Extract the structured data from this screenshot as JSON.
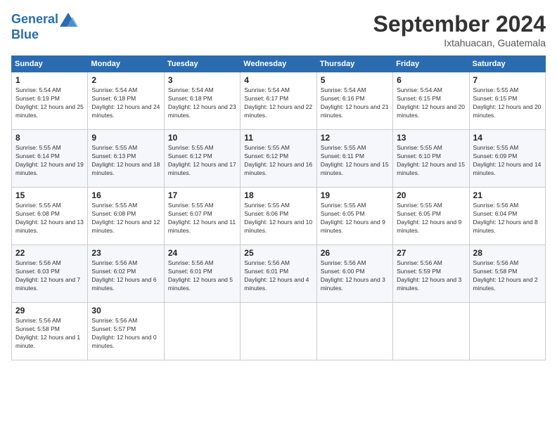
{
  "header": {
    "logo_line1": "General",
    "logo_line2": "Blue",
    "month": "September 2024",
    "location": "Ixtahuacan, Guatemala"
  },
  "days_of_week": [
    "Sunday",
    "Monday",
    "Tuesday",
    "Wednesday",
    "Thursday",
    "Friday",
    "Saturday"
  ],
  "weeks": [
    [
      {
        "day": "1",
        "sunrise": "Sunrise: 5:54 AM",
        "sunset": "Sunset: 6:19 PM",
        "daylight": "Daylight: 12 hours and 25 minutes."
      },
      {
        "day": "2",
        "sunrise": "Sunrise: 5:54 AM",
        "sunset": "Sunset: 6:18 PM",
        "daylight": "Daylight: 12 hours and 24 minutes."
      },
      {
        "day": "3",
        "sunrise": "Sunrise: 5:54 AM",
        "sunset": "Sunset: 6:18 PM",
        "daylight": "Daylight: 12 hours and 23 minutes."
      },
      {
        "day": "4",
        "sunrise": "Sunrise: 5:54 AM",
        "sunset": "Sunset: 6:17 PM",
        "daylight": "Daylight: 12 hours and 22 minutes."
      },
      {
        "day": "5",
        "sunrise": "Sunrise: 5:54 AM",
        "sunset": "Sunset: 6:16 PM",
        "daylight": "Daylight: 12 hours and 21 minutes."
      },
      {
        "day": "6",
        "sunrise": "Sunrise: 5:54 AM",
        "sunset": "Sunset: 6:15 PM",
        "daylight": "Daylight: 12 hours and 20 minutes."
      },
      {
        "day": "7",
        "sunrise": "Sunrise: 5:55 AM",
        "sunset": "Sunset: 6:15 PM",
        "daylight": "Daylight: 12 hours and 20 minutes."
      }
    ],
    [
      {
        "day": "8",
        "sunrise": "Sunrise: 5:55 AM",
        "sunset": "Sunset: 6:14 PM",
        "daylight": "Daylight: 12 hours and 19 minutes."
      },
      {
        "day": "9",
        "sunrise": "Sunrise: 5:55 AM",
        "sunset": "Sunset: 6:13 PM",
        "daylight": "Daylight: 12 hours and 18 minutes."
      },
      {
        "day": "10",
        "sunrise": "Sunrise: 5:55 AM",
        "sunset": "Sunset: 6:12 PM",
        "daylight": "Daylight: 12 hours and 17 minutes."
      },
      {
        "day": "11",
        "sunrise": "Sunrise: 5:55 AM",
        "sunset": "Sunset: 6:12 PM",
        "daylight": "Daylight: 12 hours and 16 minutes."
      },
      {
        "day": "12",
        "sunrise": "Sunrise: 5:55 AM",
        "sunset": "Sunset: 6:11 PM",
        "daylight": "Daylight: 12 hours and 15 minutes."
      },
      {
        "day": "13",
        "sunrise": "Sunrise: 5:55 AM",
        "sunset": "Sunset: 6:10 PM",
        "daylight": "Daylight: 12 hours and 15 minutes."
      },
      {
        "day": "14",
        "sunrise": "Sunrise: 5:55 AM",
        "sunset": "Sunset: 6:09 PM",
        "daylight": "Daylight: 12 hours and 14 minutes."
      }
    ],
    [
      {
        "day": "15",
        "sunrise": "Sunrise: 5:55 AM",
        "sunset": "Sunset: 6:08 PM",
        "daylight": "Daylight: 12 hours and 13 minutes."
      },
      {
        "day": "16",
        "sunrise": "Sunrise: 5:55 AM",
        "sunset": "Sunset: 6:08 PM",
        "daylight": "Daylight: 12 hours and 12 minutes."
      },
      {
        "day": "17",
        "sunrise": "Sunrise: 5:55 AM",
        "sunset": "Sunset: 6:07 PM",
        "daylight": "Daylight: 12 hours and 11 minutes."
      },
      {
        "day": "18",
        "sunrise": "Sunrise: 5:55 AM",
        "sunset": "Sunset: 6:06 PM",
        "daylight": "Daylight: 12 hours and 10 minutes."
      },
      {
        "day": "19",
        "sunrise": "Sunrise: 5:55 AM",
        "sunset": "Sunset: 6:05 PM",
        "daylight": "Daylight: 12 hours and 9 minutes."
      },
      {
        "day": "20",
        "sunrise": "Sunrise: 5:55 AM",
        "sunset": "Sunset: 6:05 PM",
        "daylight": "Daylight: 12 hours and 9 minutes."
      },
      {
        "day": "21",
        "sunrise": "Sunrise: 5:56 AM",
        "sunset": "Sunset: 6:04 PM",
        "daylight": "Daylight: 12 hours and 8 minutes."
      }
    ],
    [
      {
        "day": "22",
        "sunrise": "Sunrise: 5:56 AM",
        "sunset": "Sunset: 6:03 PM",
        "daylight": "Daylight: 12 hours and 7 minutes."
      },
      {
        "day": "23",
        "sunrise": "Sunrise: 5:56 AM",
        "sunset": "Sunset: 6:02 PM",
        "daylight": "Daylight: 12 hours and 6 minutes."
      },
      {
        "day": "24",
        "sunrise": "Sunrise: 5:56 AM",
        "sunset": "Sunset: 6:01 PM",
        "daylight": "Daylight: 12 hours and 5 minutes."
      },
      {
        "day": "25",
        "sunrise": "Sunrise: 5:56 AM",
        "sunset": "Sunset: 6:01 PM",
        "daylight": "Daylight: 12 hours and 4 minutes."
      },
      {
        "day": "26",
        "sunrise": "Sunrise: 5:56 AM",
        "sunset": "Sunset: 6:00 PM",
        "daylight": "Daylight: 12 hours and 3 minutes."
      },
      {
        "day": "27",
        "sunrise": "Sunrise: 5:56 AM",
        "sunset": "Sunset: 5:59 PM",
        "daylight": "Daylight: 12 hours and 3 minutes."
      },
      {
        "day": "28",
        "sunrise": "Sunrise: 5:56 AM",
        "sunset": "Sunset: 5:58 PM",
        "daylight": "Daylight: 12 hours and 2 minutes."
      }
    ],
    [
      {
        "day": "29",
        "sunrise": "Sunrise: 5:56 AM",
        "sunset": "Sunset: 5:58 PM",
        "daylight": "Daylight: 12 hours and 1 minute."
      },
      {
        "day": "30",
        "sunrise": "Sunrise: 5:56 AM",
        "sunset": "Sunset: 5:57 PM",
        "daylight": "Daylight: 12 hours and 0 minutes."
      },
      null,
      null,
      null,
      null,
      null
    ]
  ]
}
